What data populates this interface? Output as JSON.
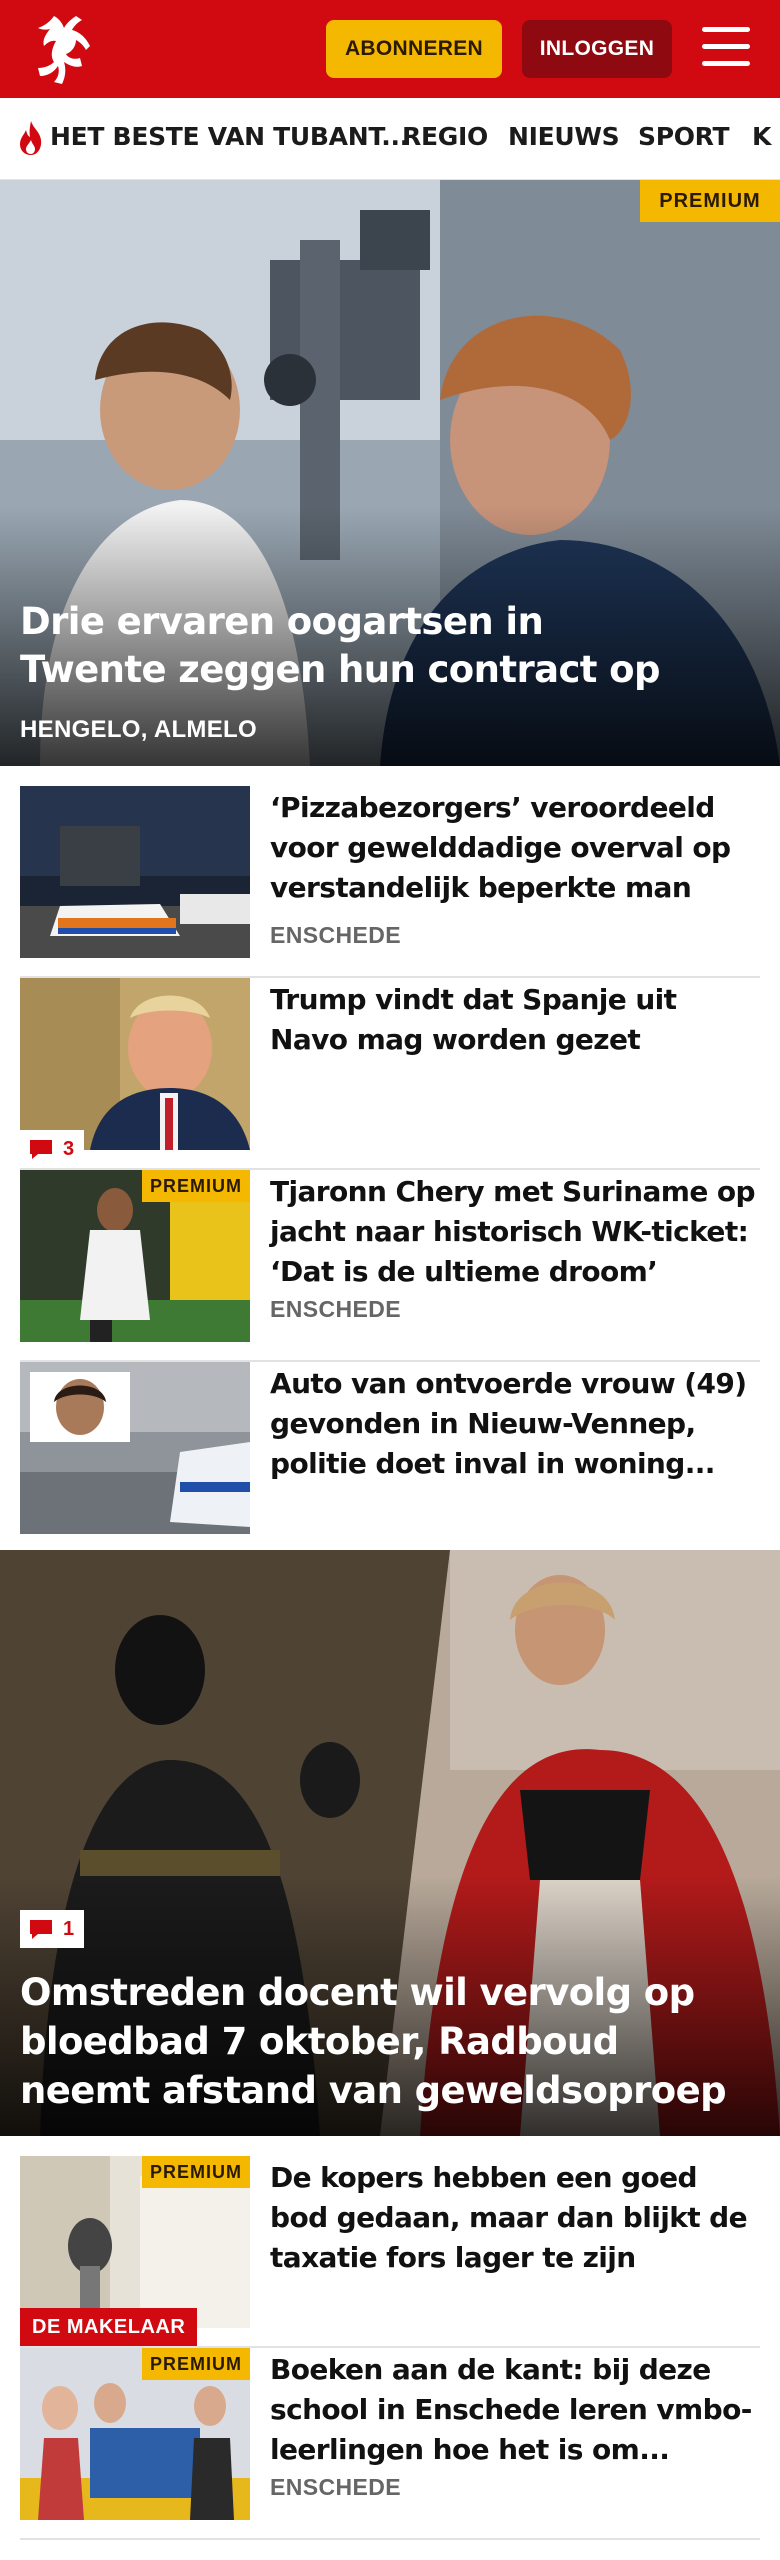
{
  "header": {
    "subscribe_label": "ABONNEREN",
    "login_label": "INLOGGEN",
    "brand_color": "#d10a11",
    "accent_color": "#f5b800"
  },
  "nav": {
    "items": [
      {
        "label": "HET BESTE VAN TUBANT..."
      },
      {
        "label": "REGIO"
      },
      {
        "label": "NIEUWS"
      },
      {
        "label": "SPORT"
      },
      {
        "label": "K"
      }
    ]
  },
  "hero": {
    "badge": "PREMIUM",
    "title": "Drie ervaren oogartsen in Twente zeggen hun contract op",
    "location": "HENGELO, ALMELO"
  },
  "articles": [
    {
      "title": "‘Pizzabezorgers’ veroordeeld voor gewelddadige overval op verstandelijk beperkte man",
      "location": "ENSCHEDE"
    },
    {
      "title": "Trump vindt dat Spanje uit Navo mag worden gezet",
      "comments": "3"
    },
    {
      "title": "Tjaronn Chery met Suriname op jacht naar historisch WK-ticket: ‘Dat is de ultieme droom’",
      "location": "ENSCHEDE",
      "badge": "PREMIUM"
    },
    {
      "title": "Auto van ontvoerde vrouw (49) gevonden in Nieuw-Vennep, politie doet inval in woning..."
    }
  ],
  "feature": {
    "comments": "1",
    "title": "Omstreden docent wil vervolg op bloedbad 7 oktober, Radboud neemt afstand van geweldsoproep"
  },
  "articles2": [
    {
      "title": "De kopers hebben een goed bod gedaan, maar dan blijkt de taxatie fors lager te zijn",
      "badge": "PREMIUM",
      "label": "DE MAKELAAR"
    },
    {
      "title": "Boeken aan de kant: bij deze school in Enschede leren vmbo-leerlingen hoe het is om...",
      "location": "ENSCHEDE",
      "badge": "PREMIUM"
    }
  ]
}
